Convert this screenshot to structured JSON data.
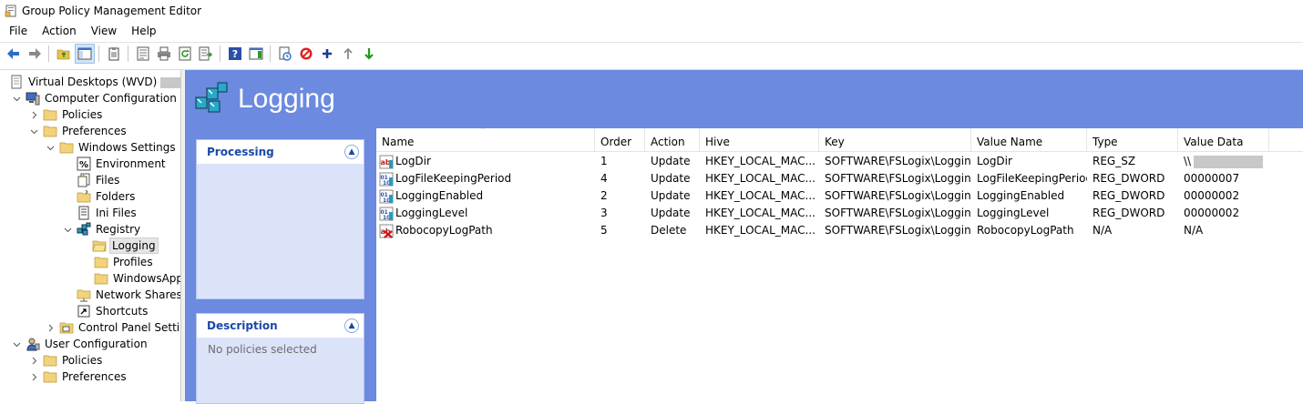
{
  "window": {
    "title": "Group Policy Management Editor"
  },
  "menu": [
    "File",
    "Action",
    "View",
    "Help"
  ],
  "toolbar": [
    {
      "icon": "back-arrow-icon"
    },
    {
      "icon": "forward-arrow-icon"
    },
    {
      "icon": "up-folder-icon"
    },
    {
      "icon": "show-hide-tree-icon"
    },
    {
      "icon": "clipboard-icon"
    },
    {
      "icon": "properties-icon"
    },
    {
      "icon": "print-icon"
    },
    {
      "icon": "refresh-icon"
    },
    {
      "icon": "export-list-icon"
    },
    {
      "icon": "help-icon"
    },
    {
      "icon": "show-action-pane-icon"
    },
    {
      "icon": "new-item-icon"
    },
    {
      "icon": "stop-icon"
    },
    {
      "icon": "add-icon"
    },
    {
      "icon": "move-up-icon"
    },
    {
      "icon": "move-down-icon"
    }
  ],
  "tree": {
    "root": "Virtual Desktops (WVD)",
    "computer_config": "Computer Configuration",
    "cc_policies": "Policies",
    "cc_preferences": "Preferences",
    "windows_settings": "Windows Settings",
    "environment": "Environment",
    "files": "Files",
    "folders": "Folders",
    "ini_files": "Ini Files",
    "registry": "Registry",
    "logging": "Logging",
    "profiles": "Profiles",
    "windowsapp": "WindowsApp",
    "network_shares": "Network Shares",
    "shortcuts": "Shortcuts",
    "control_panel": "Control Panel Settings",
    "user_config": "User Configuration",
    "uc_policies": "Policies",
    "uc_preferences": "Preferences"
  },
  "content": {
    "title": "Logging",
    "processing": {
      "title": "Processing"
    },
    "description": {
      "title": "Description",
      "text": "No policies selected"
    }
  },
  "list": {
    "columns": [
      "Name",
      "Order",
      "Action",
      "Hive",
      "Key",
      "Value Name",
      "Type",
      "Value Data"
    ],
    "rows": [
      {
        "name": "LogDir",
        "order": "1",
        "action": "Update",
        "hive": "HKEY_LOCAL_MAC...",
        "key": "SOFTWARE\\FSLogix\\Logging",
        "value_name": "LogDir",
        "type": "REG_SZ",
        "value_data": "\\\\",
        "icon": "registry-string-icon"
      },
      {
        "name": "LogFileKeepingPeriod",
        "order": "4",
        "action": "Update",
        "hive": "HKEY_LOCAL_MAC...",
        "key": "SOFTWARE\\FSLogix\\Logging",
        "value_name": "LogFileKeepingPeriod",
        "type": "REG_DWORD",
        "value_data": "00000007",
        "icon": "registry-dword-icon"
      },
      {
        "name": "LoggingEnabled",
        "order": "2",
        "action": "Update",
        "hive": "HKEY_LOCAL_MAC...",
        "key": "SOFTWARE\\FSLogix\\Logging",
        "value_name": "LoggingEnabled",
        "type": "REG_DWORD",
        "value_data": "00000002",
        "icon": "registry-dword-icon"
      },
      {
        "name": "LoggingLevel",
        "order": "3",
        "action": "Update",
        "hive": "HKEY_LOCAL_MAC...",
        "key": "SOFTWARE\\FSLogix\\Logging",
        "value_name": "LoggingLevel",
        "type": "REG_DWORD",
        "value_data": "00000002",
        "icon": "registry-dword-icon"
      },
      {
        "name": "RobocopyLogPath",
        "order": "5",
        "action": "Delete",
        "hive": "HKEY_LOCAL_MAC...",
        "key": "SOFTWARE\\FSLogix\\Logging",
        "value_name": "RobocopyLogPath",
        "type": "N/A",
        "value_data": "N/A",
        "icon": "registry-delete-icon"
      }
    ]
  },
  "colors": {
    "content_bg": "#6b8ae0",
    "panel_bg": "#dbe3f9",
    "panel_title": "#1a48a8"
  }
}
